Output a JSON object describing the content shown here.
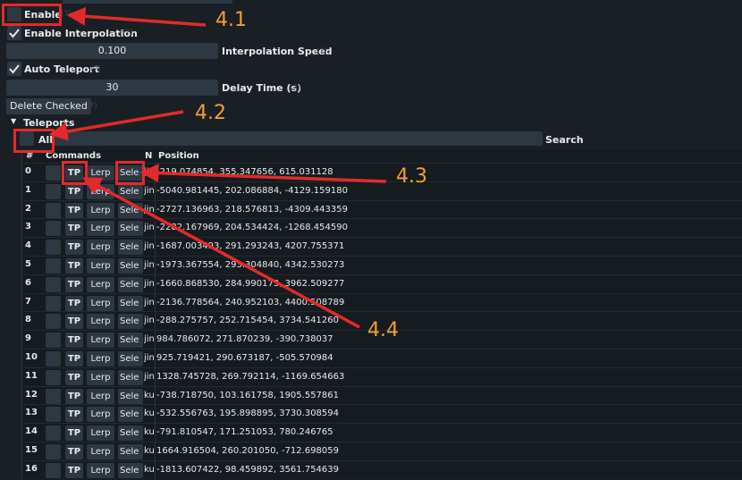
{
  "settings": {
    "enable_label": "Enable",
    "enable_interp_label": "Enable Interpolation",
    "interp_speed_value": "0.100",
    "interp_speed_label": "Interpolation Speed",
    "auto_teleport_label": "Auto Teleport",
    "delay_value": "30",
    "delay_label": "Delay Time (s)",
    "delete_checked_label": "Delete Checked",
    "hint": "(?)"
  },
  "teleports": {
    "section_label": "Teleports",
    "all_label": "All",
    "search_label": "Search"
  },
  "table": {
    "headers": {
      "num": "#",
      "commands": "Commands",
      "name": "N",
      "position": "Position"
    },
    "tp_label": "TP",
    "lerp_label": "Lerp",
    "select_label": "Sele",
    "rows": [
      {
        "num": "0",
        "name": "jin",
        "position": "-219.074854, 355.347656, 615.031128"
      },
      {
        "num": "1",
        "name": "jin",
        "position": "-5040.981445, 202.086884, -4129.159180"
      },
      {
        "num": "2",
        "name": "jin",
        "position": "-2727.136963, 218.576813, -4309.443359"
      },
      {
        "num": "3",
        "name": "jin",
        "position": "-2282.167969, 204.534424, -1268.454590"
      },
      {
        "num": "4",
        "name": "jin",
        "position": "-1687.003493, 291.293243, 4207.755371"
      },
      {
        "num": "5",
        "name": "jin",
        "position": "-1973.367554, 293.304840, 4342.530273"
      },
      {
        "num": "6",
        "name": "jin",
        "position": "-1660.868530, 284.990173, 3962.509277"
      },
      {
        "num": "7",
        "name": "jin",
        "position": "-2136.778564, 240.952103, 4400.508789"
      },
      {
        "num": "8",
        "name": "jin",
        "position": "-288.275757, 252.715454, 3734.541260"
      },
      {
        "num": "9",
        "name": "jin",
        "position": "984.786072, 271.870239, -390.738037"
      },
      {
        "num": "10",
        "name": "jin",
        "position": "925.719421, 290.673187, -505.570984"
      },
      {
        "num": "11",
        "name": "jin",
        "position": "1328.745728, 269.792114, -1169.654663"
      },
      {
        "num": "12",
        "name": "ku",
        "position": "-738.718750, 103.161758, 1905.557861"
      },
      {
        "num": "13",
        "name": "ku",
        "position": "-532.556763, 195.898895, 3730.308594"
      },
      {
        "num": "14",
        "name": "ku",
        "position": "-791.810547, 171.251053, 780.246765"
      },
      {
        "num": "15",
        "name": "ku",
        "position": "1664.916504, 260.201050, -712.698059"
      },
      {
        "num": "16",
        "name": "ku",
        "position": "-1813.607422, 98.459892, 3561.754639"
      }
    ]
  },
  "annotations": {
    "a41": "4.1",
    "a42": "4.2",
    "a43": "4.3",
    "a44": "4.4",
    "color": "#e32a2a",
    "label_color": "#f0a030"
  }
}
